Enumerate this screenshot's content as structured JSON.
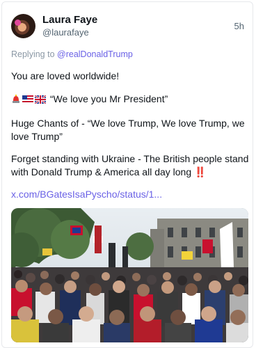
{
  "post": {
    "author_name": "Laura Faye",
    "author_handle": "@laurafaye",
    "time": "5h",
    "replying_prefix": "Replying to ",
    "replying_mention": "@realDonaldTrump",
    "line1": "You are loved worldwide!",
    "line2_emojis": [
      "police-light-emoji",
      "us-flag-emoji",
      "uk-flag-emoji"
    ],
    "line2_text": "“We love you Mr President”",
    "line3": "Huge Chants of - “We love Trump, We love Trump, we love Trump”",
    "line4": "Forget standing with Ukraine - The British people stand with Donald Trump & America all day long",
    "line4_emoji": "‼️",
    "link": "x.com/BGatesIsaPyscho/status/1...",
    "media_description_icon": "crowd-photo"
  },
  "colors": {
    "accent": "#6a61e6",
    "muted": "#536471"
  }
}
